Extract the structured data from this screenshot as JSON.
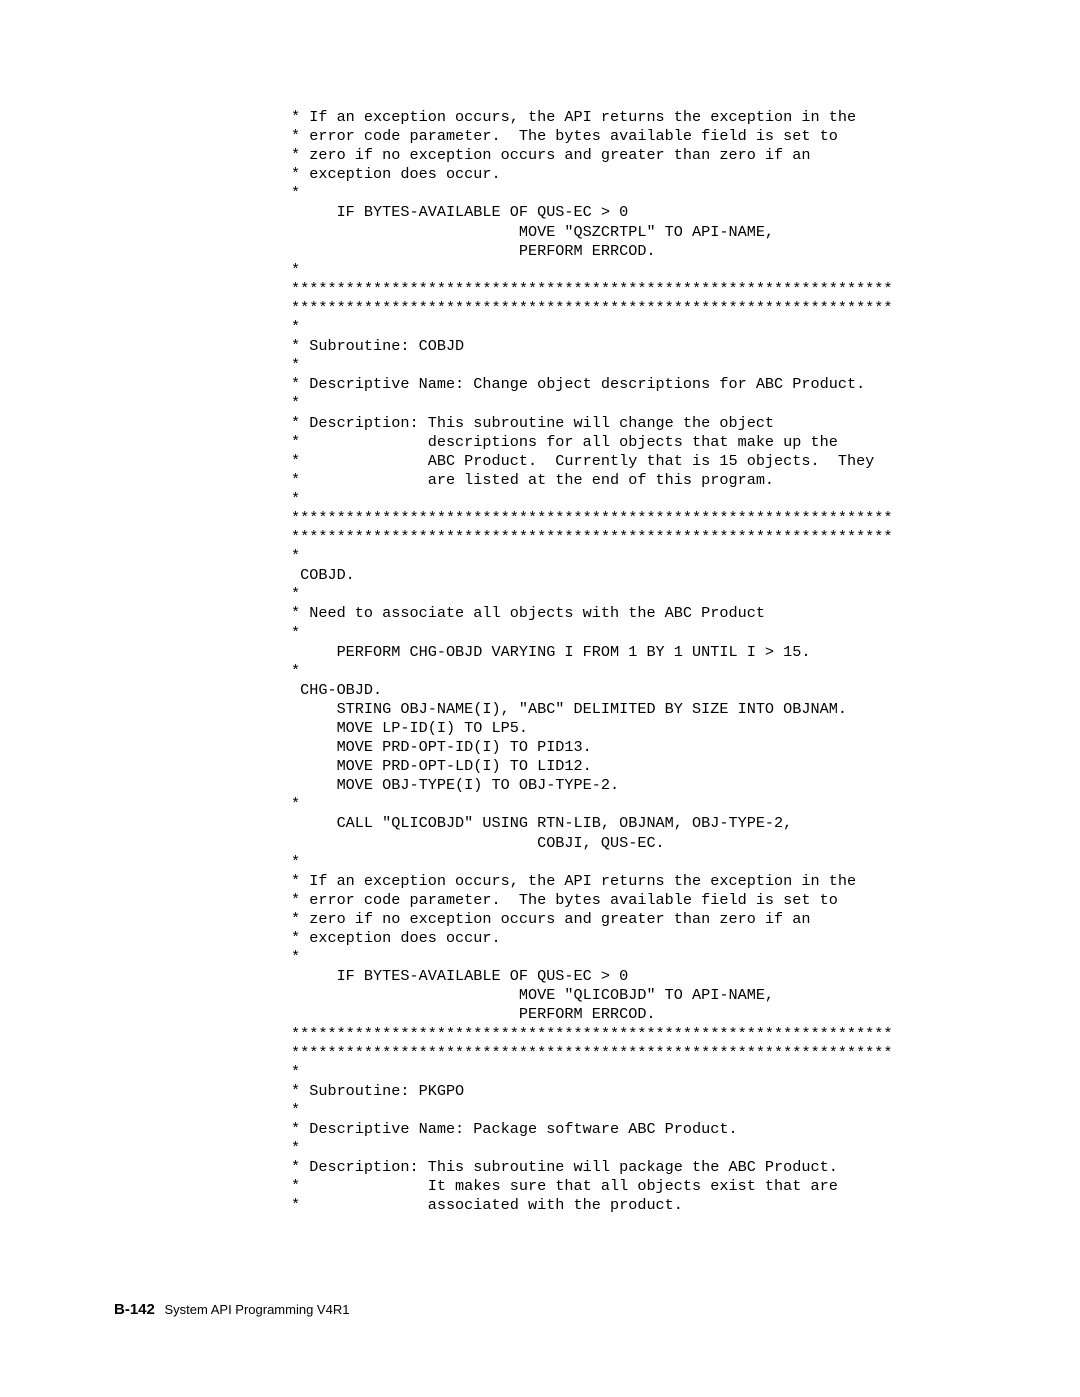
{
  "code": {
    "lines": [
      "* If an exception occurs, the API returns the exception in the",
      "* error code parameter.  The bytes available field is set to",
      "* zero if no exception occurs and greater than zero if an",
      "* exception does occur.",
      "*",
      "     IF BYTES-AVAILABLE OF QUS-EC > 0",
      "                         MOVE \"QSZCRTPL\" TO API-NAME,",
      "                         PERFORM ERRCOD.",
      "*",
      "******************************************************************",
      "******************************************************************",
      "*",
      "* Subroutine: COBJD",
      "*",
      "* Descriptive Name: Change object descriptions for ABC Product.",
      "*",
      "* Description: This subroutine will change the object",
      "*              descriptions for all objects that make up the",
      "*              ABC Product.  Currently that is 15 objects.  They",
      "*              are listed at the end of this program.",
      "*",
      "******************************************************************",
      "******************************************************************",
      "*",
      " COBJD.",
      "*",
      "* Need to associate all objects with the ABC Product",
      "*",
      "     PERFORM CHG-OBJD VARYING I FROM 1 BY 1 UNTIL I > 15.",
      "*",
      " CHG-OBJD.",
      "     STRING OBJ-NAME(I), \"ABC\" DELIMITED BY SIZE INTO OBJNAM.",
      "     MOVE LP-ID(I) TO LP5.",
      "     MOVE PRD-OPT-ID(I) TO PID13.",
      "     MOVE PRD-OPT-LD(I) TO LID12.",
      "     MOVE OBJ-TYPE(I) TO OBJ-TYPE-2.",
      "*",
      "     CALL \"QLICOBJD\" USING RTN-LIB, OBJNAM, OBJ-TYPE-2,",
      "                           COBJI, QUS-EC.",
      "*",
      "* If an exception occurs, the API returns the exception in the",
      "* error code parameter.  The bytes available field is set to",
      "* zero if no exception occurs and greater than zero if an",
      "* exception does occur.",
      "*",
      "     IF BYTES-AVAILABLE OF QUS-EC > 0",
      "                         MOVE \"QLICOBJD\" TO API-NAME,",
      "                         PERFORM ERRCOD.",
      "******************************************************************",
      "******************************************************************",
      "*",
      "* Subroutine: PKGPO",
      "*",
      "* Descriptive Name: Package software ABC Product.",
      "*",
      "* Description: This subroutine will package the ABC Product.",
      "*              It makes sure that all objects exist that are",
      "*              associated with the product."
    ]
  },
  "footer": {
    "page_num": "B-142",
    "title": "System API Programming V4R1"
  }
}
